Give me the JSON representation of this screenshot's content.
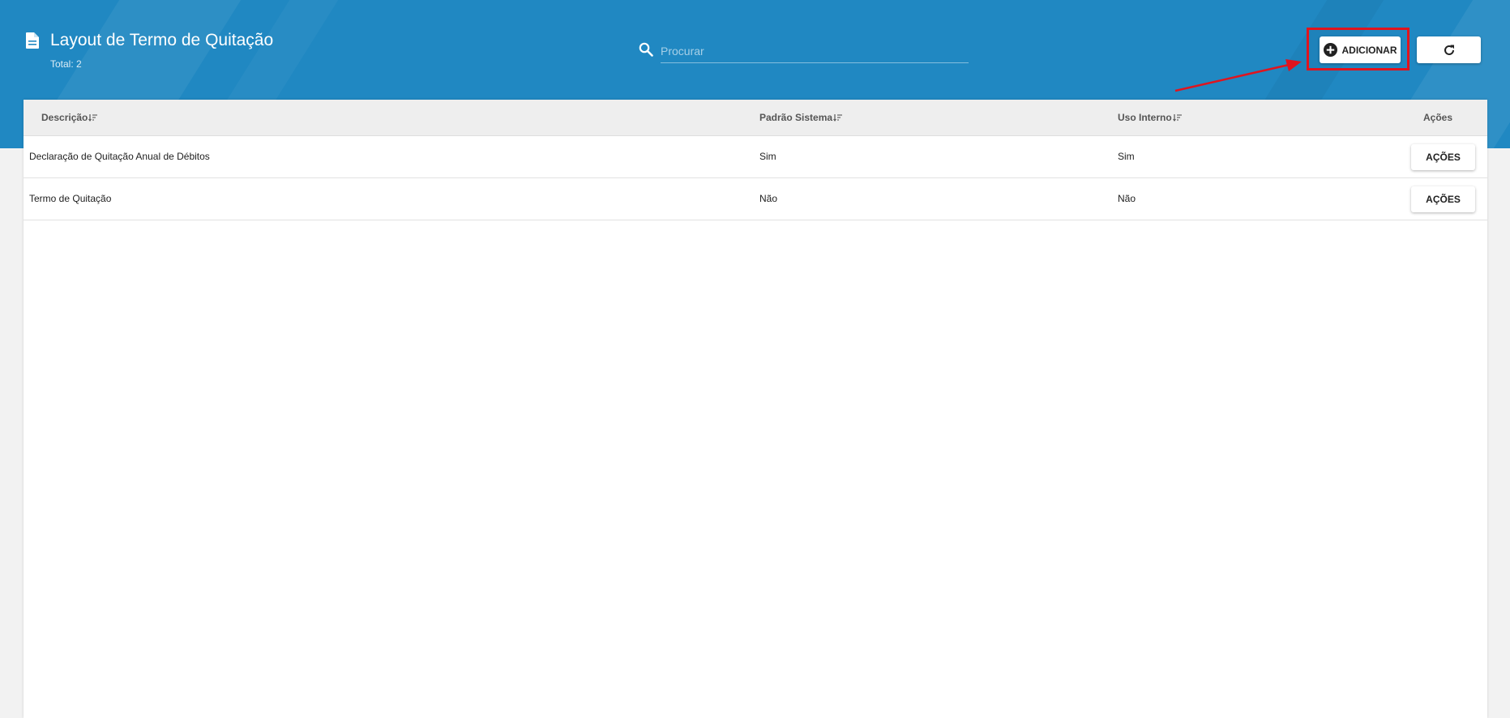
{
  "header": {
    "title": "Layout de Termo de Quitação",
    "total": "Total: 2",
    "search": {
      "placeholder": "Procurar",
      "value": ""
    },
    "add_label": "ADICIONAR"
  },
  "colors": {
    "header_bg": "#2088c2",
    "annotation": "#e0141e"
  },
  "table": {
    "columns": [
      "Descrição",
      "Padrão Sistema",
      "Uso Interno",
      "Ações"
    ],
    "rows": [
      {
        "descricao": "Declaração de Quitação Anual de Débitos",
        "padrao": "Sim",
        "uso": "Sim",
        "action": "AÇÕES"
      },
      {
        "descricao": "Termo de Quitação",
        "padrao": "Não",
        "uso": "Não",
        "action": "AÇÕES"
      }
    ]
  },
  "icons": {
    "title": "document-icon",
    "search": "search-icon",
    "add": "plus-circle-icon",
    "refresh": "refresh-icon",
    "sort": "sort-icon"
  }
}
